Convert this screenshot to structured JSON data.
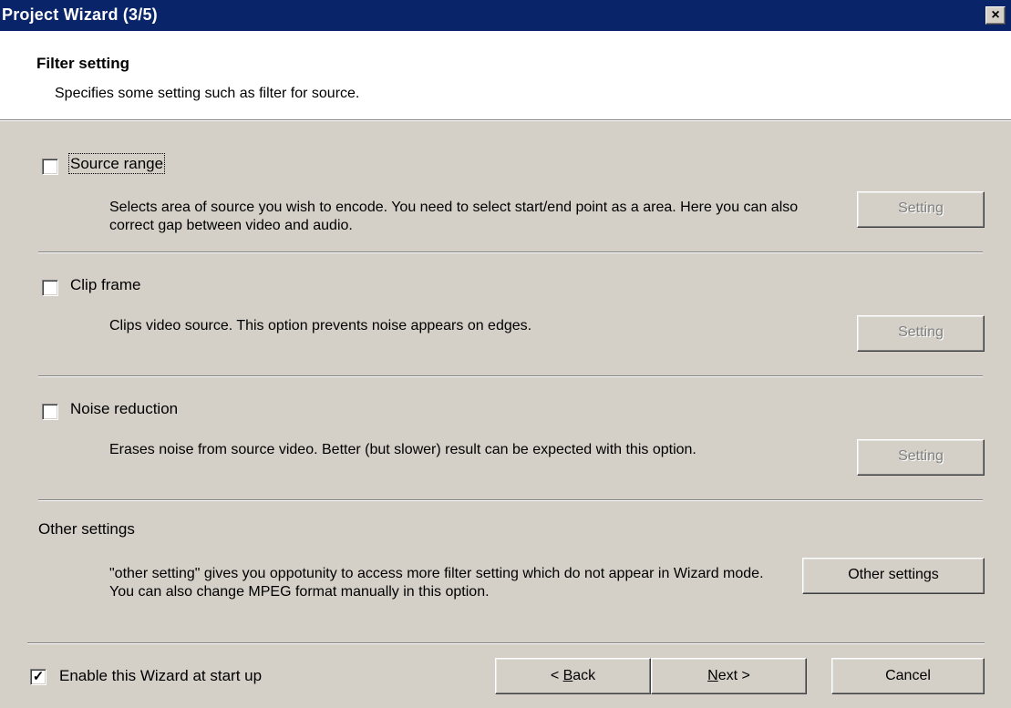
{
  "window": {
    "title": "Project Wizard (3/5)",
    "close_glyph": "×"
  },
  "header": {
    "title": "Filter setting",
    "description": "Specifies some setting such as filter for source."
  },
  "options": [
    {
      "label": "Source range",
      "checked": false,
      "description": "Selects area of source you wish to encode. You need to select start/end point as a area. Here you can also correct gap between video and audio.",
      "button_label": "Setting",
      "button_enabled": false
    },
    {
      "label": "Clip frame",
      "checked": false,
      "description": "Clips video source. This option prevents noise appears on edges.",
      "button_label": "Setting",
      "button_enabled": false
    },
    {
      "label": "Noise reduction",
      "checked": false,
      "description": "Erases noise from source video. Better (but slower) result can be expected with this option.",
      "button_label": "Setting",
      "button_enabled": false
    }
  ],
  "other": {
    "heading": "Other settings",
    "description": "\"other setting\" gives you oppotunity to access more filter setting which do not appear in Wizard mode. You can also change MPEG format manually in this option.",
    "button_label": "Other settings"
  },
  "footer": {
    "startup_checkbox_label": "Enable this Wizard at start up",
    "startup_checked": true,
    "back_prefix": "< ",
    "back_mnemonic": "B",
    "back_rest": "ack",
    "next_mnemonic": "N",
    "next_rest": "ext >",
    "cancel_label": "Cancel"
  },
  "colors": {
    "titlebar": "#0a246a",
    "dialog_face": "#d4d0c8",
    "header_bg": "#ffffff"
  }
}
